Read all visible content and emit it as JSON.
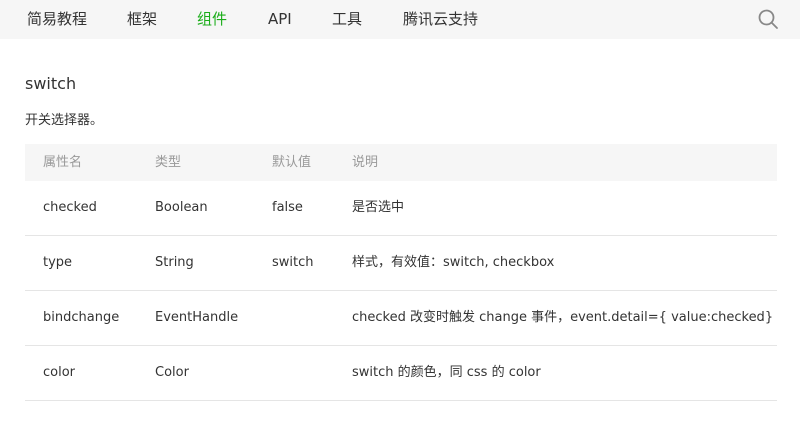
{
  "nav": {
    "items": [
      {
        "label": "简易教程"
      },
      {
        "label": "框架"
      },
      {
        "label": "组件",
        "active": true
      },
      {
        "label": "API"
      },
      {
        "label": "工具"
      },
      {
        "label": "腾讯云支持"
      }
    ],
    "search_icon": "search-icon"
  },
  "colors": {
    "accent": "#1aad19",
    "topbar_bg": "#f6f6f6",
    "header_text": "#999999",
    "text": "#333333",
    "divider": "#e5e5e5"
  },
  "page": {
    "title": "switch",
    "description": "开关选择器。"
  },
  "table": {
    "headers": [
      "属性名",
      "类型",
      "默认值",
      "说明"
    ],
    "rows": [
      [
        "checked",
        "Boolean",
        "false",
        "是否选中"
      ],
      [
        "type",
        "String",
        "switch",
        "样式，有效值：switch, checkbox"
      ],
      [
        "bindchange",
        "EventHandle",
        "",
        "checked 改变时触发 change 事件，event.detail={ value:checked}"
      ],
      [
        "color",
        "Color",
        "",
        "switch 的颜色，同 css 的 color"
      ]
    ]
  }
}
